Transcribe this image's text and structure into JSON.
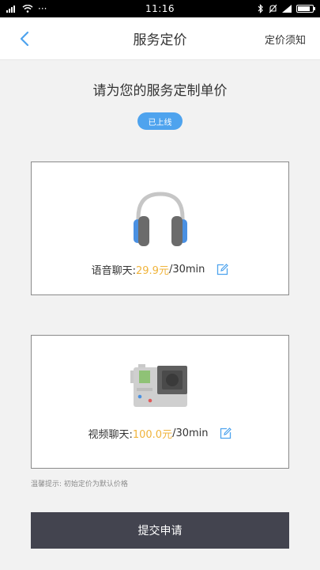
{
  "status_bar": {
    "time": "11:16",
    "dots": "···",
    "battery_level": 0.85
  },
  "nav": {
    "title": "服务定价",
    "right_link": "定价须知"
  },
  "headline": "请为您的服务定制单价",
  "badge": "已上线",
  "voice": {
    "label": "语音聊天:",
    "price": "29.9元",
    "unit": "/30min"
  },
  "video": {
    "label": "视频聊天:",
    "price": "100.0元",
    "unit": "/30min"
  },
  "tip": "温馨提示: 初始定价为默认价格",
  "submit_label": "提交申请",
  "colors": {
    "accent": "#4ea3ee",
    "price": "#f0b43c",
    "button": "#43444f",
    "background": "#f2f2f2"
  }
}
